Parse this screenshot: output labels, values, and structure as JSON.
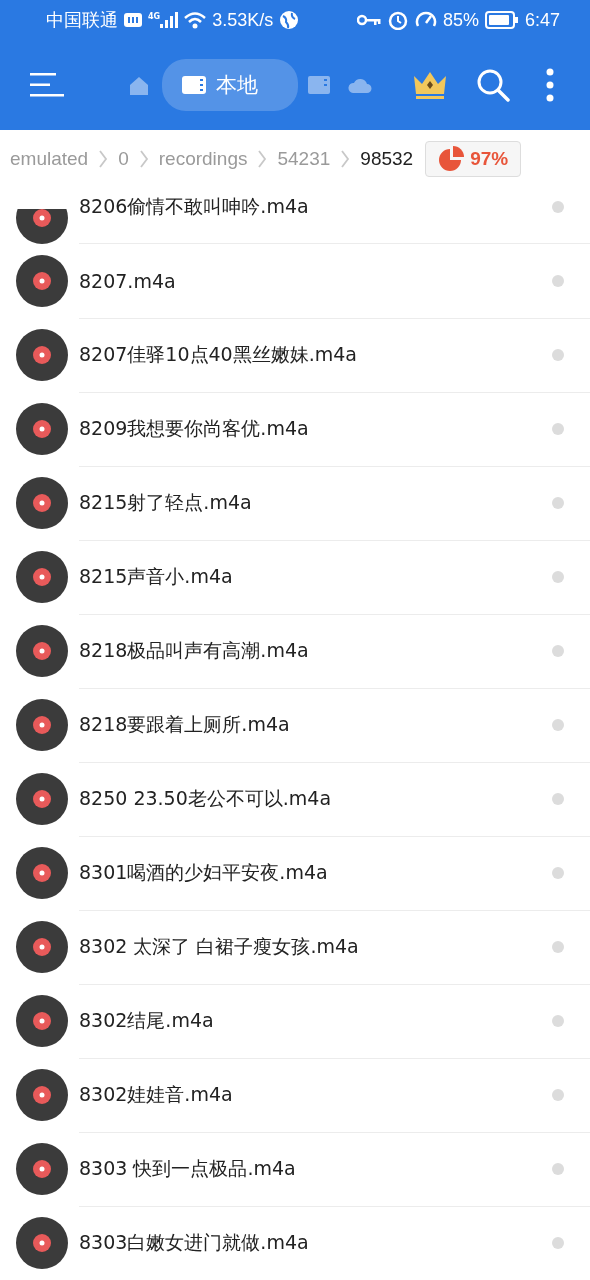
{
  "status_bar": {
    "carrier": "中国联通",
    "network": "4G",
    "speed": "3.53K/s",
    "battery": "85%",
    "time": "6:47"
  },
  "toolbar": {
    "tabs": [
      {
        "kind": "home",
        "selected": false
      },
      {
        "kind": "local",
        "label": "本地",
        "selected": true
      },
      {
        "kind": "sdcard",
        "selected": false
      },
      {
        "kind": "cloud",
        "selected": false
      }
    ]
  },
  "breadcrumb": {
    "items": [
      {
        "label": "emulated",
        "selected": false
      },
      {
        "label": "0",
        "selected": false
      },
      {
        "label": "recordings",
        "selected": false
      },
      {
        "label": "54231",
        "selected": false
      },
      {
        "label": "98532",
        "selected": true
      }
    ],
    "storage": "97%"
  },
  "files": [
    {
      "name": "8206偷情不敢叫呻吟.m4a",
      "checked": false
    },
    {
      "name": "8207.m4a",
      "checked": false
    },
    {
      "name": "8207佳驿10点40黑丝嫩妹.m4a",
      "checked": false
    },
    {
      "name": "8209我想要你尚客优.m4a",
      "checked": false
    },
    {
      "name": "8215射了轻点.m4a",
      "checked": false
    },
    {
      "name": "8215声音小.m4a",
      "checked": false
    },
    {
      "name": "8218极品叫声有高潮.m4a",
      "checked": false
    },
    {
      "name": "8218要跟着上厕所.m4a",
      "checked": false
    },
    {
      "name": "8250  23.50老公不可以.m4a",
      "checked": false
    },
    {
      "name": "8301喝酒的少妇平安夜.m4a",
      "checked": false
    },
    {
      "name": "8302  太深了  白裙子瘦女孩.m4a",
      "checked": false
    },
    {
      "name": "8302结尾.m4a",
      "checked": false
    },
    {
      "name": "8302娃娃音.m4a",
      "checked": false
    },
    {
      "name": "8303  快到一点极品.m4a",
      "checked": false
    },
    {
      "name": "8303白嫩女进门就做.m4a",
      "checked": false
    }
  ]
}
